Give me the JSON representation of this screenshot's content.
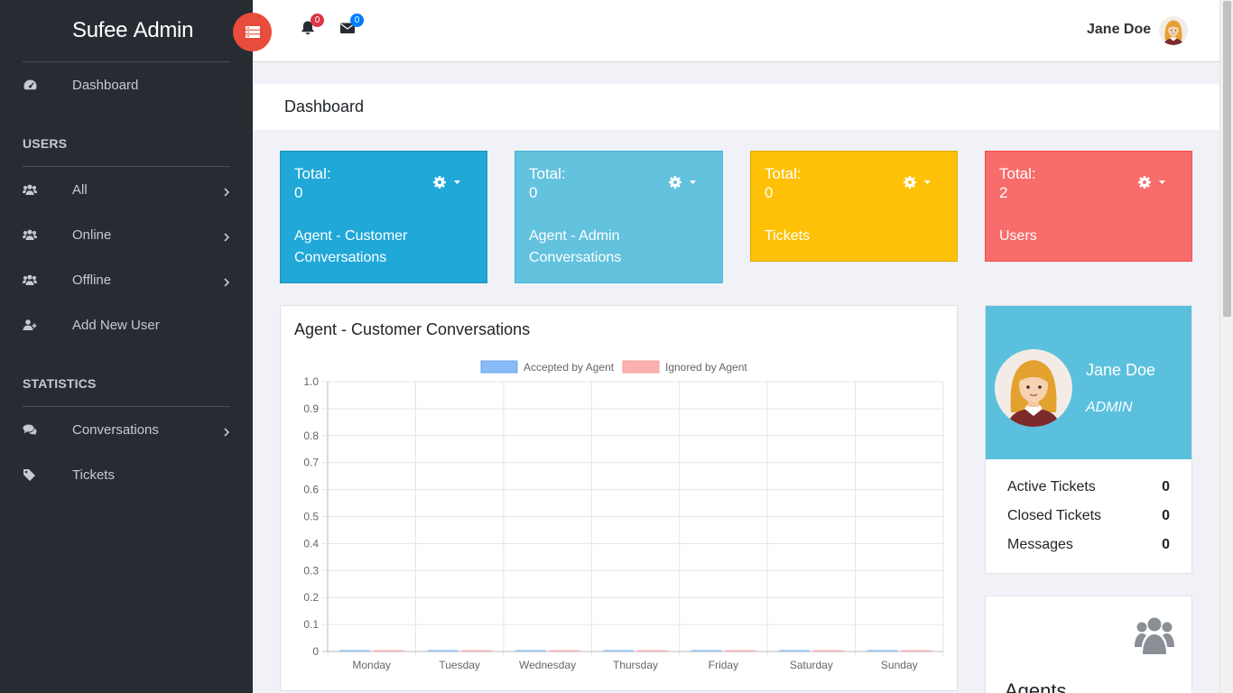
{
  "brand": {
    "name": "Sufee",
    "name_bold": "Admin"
  },
  "sidebar": {
    "dashboard": "Dashboard",
    "users_title": "USERS",
    "all": "All",
    "online": "Online",
    "offline": "Offline",
    "add_user": "Add New User",
    "statistics_title": "STATISTICS",
    "conversations": "Conversations",
    "tickets": "Tickets"
  },
  "header": {
    "notifications_count": "0",
    "messages_count": "0",
    "user_name": "Jane Doe"
  },
  "page": {
    "title": "Dashboard"
  },
  "stats": [
    {
      "label": "Total:",
      "value": "0",
      "desc": "Agent - Customer Conversations",
      "color": "#20a8d8"
    },
    {
      "label": "Total:",
      "value": "0",
      "desc": "Agent - Admin Conversations",
      "color": "#63c2de"
    },
    {
      "label": "Total:",
      "value": "0",
      "desc": "Tickets",
      "color": "#ffc107"
    },
    {
      "label": "Total:",
      "value": "2",
      "desc": "Users",
      "color": "#f86c6b"
    }
  ],
  "chart_title": "Agent - Customer Conversations",
  "chart_data": {
    "type": "bar",
    "title": "Agent - Customer Conversations",
    "categories": [
      "Monday",
      "Tuesday",
      "Wednesday",
      "Thursday",
      "Friday",
      "Saturday",
      "Sunday"
    ],
    "series": [
      {
        "name": "Accepted by Agent",
        "values": [
          0,
          0,
          0,
          0,
          0,
          0,
          0
        ],
        "color": "#88bbf7"
      },
      {
        "name": "Ignored by Agent",
        "values": [
          0,
          0,
          0,
          0,
          0,
          0,
          0
        ],
        "color": "#fbb0b0"
      }
    ],
    "yticks": [
      "0",
      "0.1",
      "0.2",
      "0.3",
      "0.4",
      "0.5",
      "0.6",
      "0.7",
      "0.8",
      "0.9",
      "1.0"
    ],
    "ylim": [
      0,
      1
    ],
    "legend": "top-center",
    "grid": true
  },
  "profile": {
    "name": "Jane Doe",
    "role": "ADMIN",
    "rows": [
      {
        "label": "Active Tickets",
        "value": "0"
      },
      {
        "label": "Closed Tickets",
        "value": "0"
      },
      {
        "label": "Messages",
        "value": "0"
      }
    ]
  },
  "agents": {
    "title": "Agents"
  }
}
